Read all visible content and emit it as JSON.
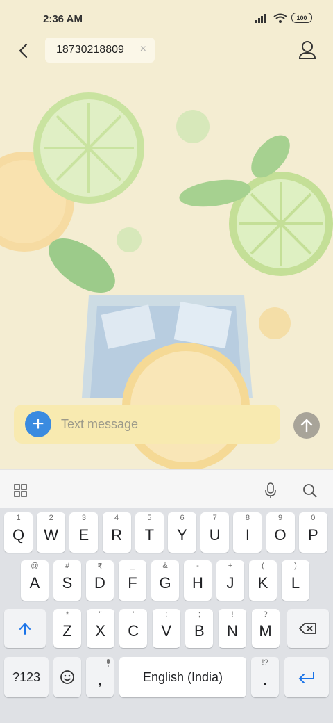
{
  "status": {
    "time": "2:36 AM",
    "battery": "100"
  },
  "header": {
    "recipient": "18730218809",
    "clear_symbol": "×"
  },
  "composer": {
    "placeholder": "Text message",
    "plus_symbol": "+"
  },
  "keyboard": {
    "row1": [
      {
        "hint": "1",
        "label": "Q"
      },
      {
        "hint": "2",
        "label": "W"
      },
      {
        "hint": "3",
        "label": "E"
      },
      {
        "hint": "4",
        "label": "R"
      },
      {
        "hint": "5",
        "label": "T"
      },
      {
        "hint": "6",
        "label": "Y"
      },
      {
        "hint": "7",
        "label": "U"
      },
      {
        "hint": "8",
        "label": "I"
      },
      {
        "hint": "9",
        "label": "O"
      },
      {
        "hint": "0",
        "label": "P"
      }
    ],
    "row2": [
      {
        "hint": "@",
        "label": "A"
      },
      {
        "hint": "#",
        "label": "S"
      },
      {
        "hint": "₹",
        "label": "D"
      },
      {
        "hint": "_",
        "label": "F"
      },
      {
        "hint": "&",
        "label": "G"
      },
      {
        "hint": "-",
        "label": "H"
      },
      {
        "hint": "+",
        "label": "J"
      },
      {
        "hint": "(",
        "label": "K"
      },
      {
        "hint": ")",
        "label": "L"
      }
    ],
    "row3": [
      {
        "hint": "*",
        "label": "Z"
      },
      {
        "hint": "\"",
        "label": "X"
      },
      {
        "hint": "'",
        "label": "C"
      },
      {
        "hint": ":",
        "label": "V"
      },
      {
        "hint": ";",
        "label": "B"
      },
      {
        "hint": "!",
        "label": "N"
      },
      {
        "hint": "?",
        "label": "M"
      }
    ],
    "symbols_key": "?123",
    "comma": ",",
    "space": "English (India)",
    "period": ".",
    "period_hint": "!?",
    "accent_color": "#1a73e8"
  },
  "icons": [
    "back-icon",
    "person-icon",
    "signal-icon",
    "wifi-icon",
    "battery-icon",
    "apps-grid-icon",
    "mic-icon",
    "search-icon",
    "shift-icon",
    "backspace-icon",
    "emoji-icon",
    "enter-icon",
    "send-icon"
  ]
}
